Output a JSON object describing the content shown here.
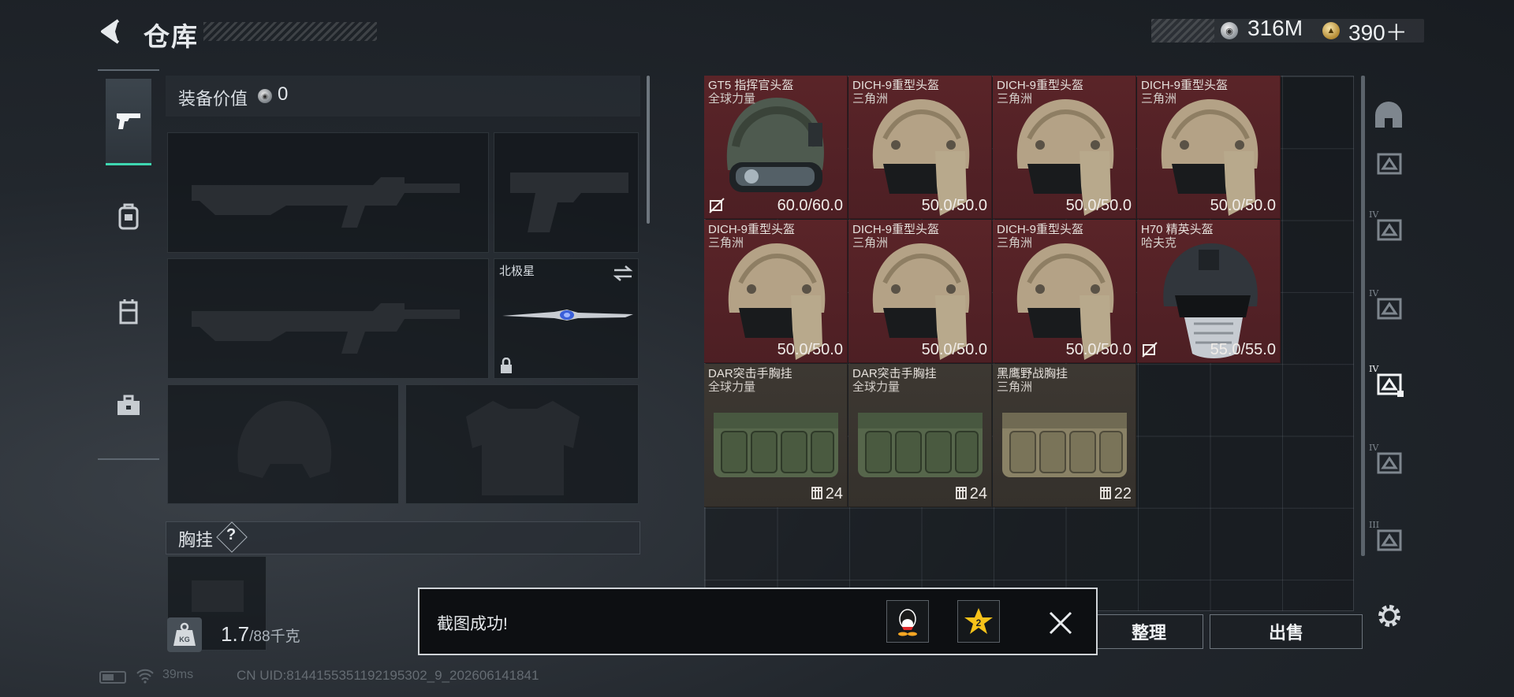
{
  "header": {
    "title": "仓库",
    "currency_silver": "316M",
    "currency_gold": "390＋"
  },
  "tabs": [
    {
      "icon": "pistol-icon",
      "active": true
    },
    {
      "icon": "backpack-icon"
    },
    {
      "icon": "chest-rig-icon"
    },
    {
      "icon": "toolbox-icon"
    }
  ],
  "equipment": {
    "value_label": "装备价值",
    "value": "0",
    "melee_name": "北极星",
    "vest_label": "胸挂",
    "help": "?"
  },
  "weight": {
    "value": "1.7",
    "unit": "/88千克"
  },
  "inventory": [
    {
      "name": "GT5 指挥官头盔",
      "faction": "全球力量",
      "durability": "60.0/60.0",
      "kind": "commander-helmet",
      "color": "red",
      "marked": true
    },
    {
      "name": "DICH-9重型头盔",
      "faction": "三角洲",
      "durability": "50.0/50.0",
      "kind": "heavy-helmet",
      "color": "red"
    },
    {
      "name": "DICH-9重型头盔",
      "faction": "三角洲",
      "durability": "50.0/50.0",
      "kind": "heavy-helmet",
      "color": "red"
    },
    {
      "name": "DICH-9重型头盔",
      "faction": "三角洲",
      "durability": "50.0/50.0",
      "kind": "heavy-helmet",
      "color": "red"
    },
    {
      "name": "DICH-9重型头盔",
      "faction": "三角洲",
      "durability": "50.0/50.0",
      "kind": "heavy-helmet",
      "color": "red"
    },
    {
      "name": "DICH-9重型头盔",
      "faction": "三角洲",
      "durability": "50.0/50.0",
      "kind": "heavy-helmet",
      "color": "red"
    },
    {
      "name": "DICH-9重型头盔",
      "faction": "三角洲",
      "durability": "50.0/50.0",
      "kind": "heavy-helmet",
      "color": "red"
    },
    {
      "name": "H70 精英头盔",
      "faction": "哈夫克",
      "durability": "55.0/55.0",
      "kind": "elite-helmet",
      "color": "red",
      "marked": true
    },
    {
      "name": "DAR突击手胸挂",
      "faction": "全球力量",
      "capacity": "24",
      "kind": "chest-rig-green",
      "color": "brown"
    },
    {
      "name": "DAR突击手胸挂",
      "faction": "全球力量",
      "capacity": "24",
      "kind": "chest-rig-green",
      "color": "brown"
    },
    {
      "name": "黑鹰野战胸挂",
      "faction": "三角洲",
      "capacity": "22",
      "kind": "chest-rig-tan",
      "color": "brown"
    }
  ],
  "categories": [
    {
      "icon": "helmet-category-icon"
    },
    {
      "icon": "armor-category-icon"
    },
    {
      "icon": "tier4-helmet-icon",
      "tier": "IV"
    },
    {
      "icon": "tier4-helmet-icon-2",
      "tier": "IV"
    },
    {
      "icon": "tier4-helmet-selected-icon",
      "tier": "IV",
      "selected": true
    },
    {
      "icon": "tier4-armor-icon",
      "tier": "IV"
    },
    {
      "icon": "tier3-armor-icon",
      "tier": "III"
    }
  ],
  "buttons": {
    "sort": "整理",
    "sell": "出售"
  },
  "toast": {
    "message": "截图成功!"
  },
  "status": {
    "ping": "39ms",
    "uid": "CN UID:8144155351192195302_9_202606141841"
  },
  "colors": {
    "accent": "#3ed6b0",
    "rare_red": "#5a2428",
    "common_brown": "#3d3832"
  }
}
